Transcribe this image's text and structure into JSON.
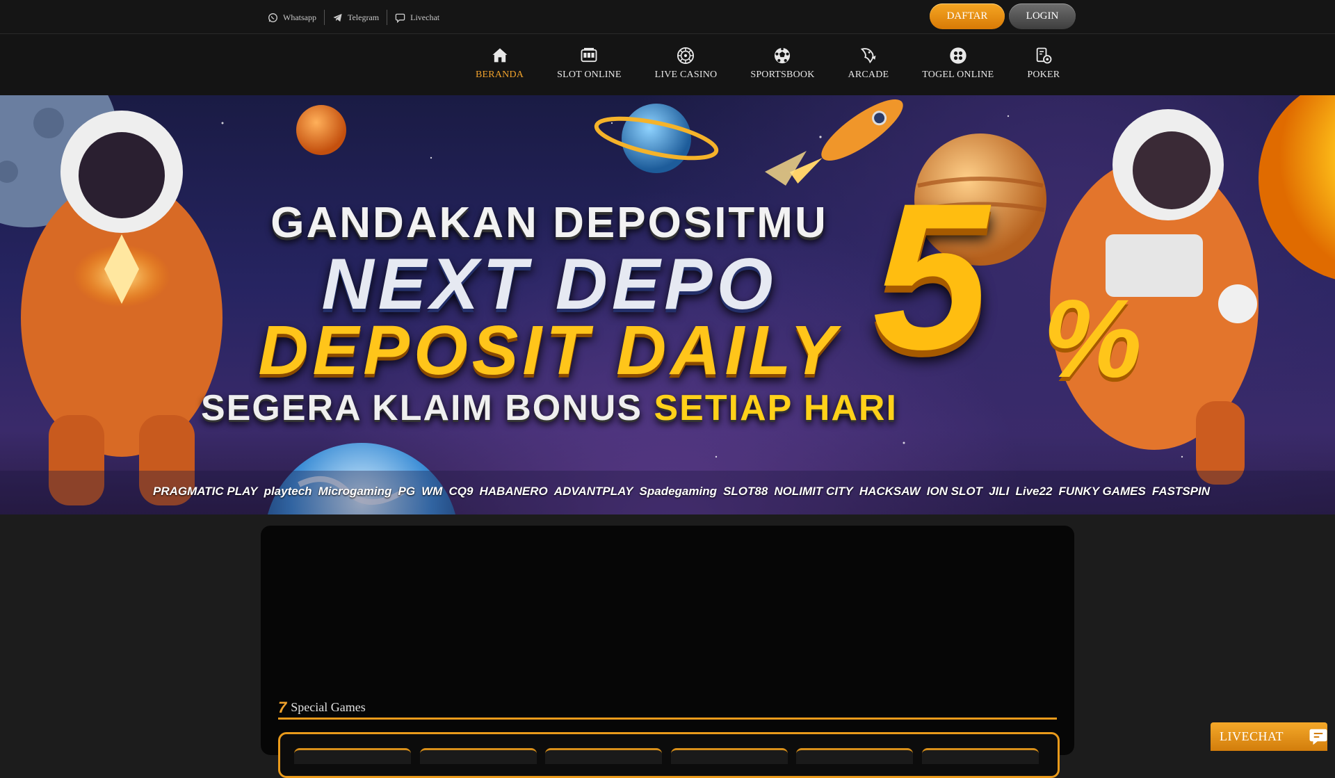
{
  "topbar": {
    "contacts": [
      {
        "label": "Whatsapp",
        "icon": "whatsapp-icon"
      },
      {
        "label": "Telegram",
        "icon": "telegram-icon"
      },
      {
        "label": "Livechat",
        "icon": "chat-bubble-icon"
      }
    ],
    "daftar_label": "DAFTAR",
    "login_label": "LOGIN"
  },
  "nav": {
    "items": [
      {
        "label": "BERANDA",
        "icon": "home-icon",
        "active": true
      },
      {
        "label": "SLOT ONLINE",
        "icon": "slot-machine-icon"
      },
      {
        "label": "LIVE CASINO",
        "icon": "roulette-icon"
      },
      {
        "label": "SPORTSBOOK",
        "icon": "soccer-ball-icon"
      },
      {
        "label": "ARCADE",
        "icon": "fish-icon"
      },
      {
        "label": "TOGEL ONLINE",
        "icon": "lottery-ball-icon"
      },
      {
        "label": "POKER",
        "icon": "poker-cards-icon"
      }
    ],
    "active_color": "#f0a22c"
  },
  "banner": {
    "line1": "GANDAKAN DEPOSITMU",
    "line2": "NEXT DEPO",
    "line3": "DEPOSIT DAILY",
    "line4_a": "SEGERA KLAIM BONUS",
    "line4_b": "SETIAP HARI",
    "percent_digit": "5",
    "percent_sign": "%",
    "providers": [
      "PRAGMATIC PLAY",
      "playtech",
      "Microgaming",
      "PG",
      "WM",
      "CQ9",
      "HABANERO",
      "ADVANTPLAY",
      "Spadegaming",
      "SLOT88",
      "NOLIMIT CITY",
      "HACKSAW",
      "ION SLOT",
      "JILI",
      "Live22",
      "FUNKY GAMES",
      "FASTSPIN"
    ]
  },
  "section": {
    "special_title": "Special Games",
    "seven_glyph": "7"
  },
  "livechat": {
    "label": "LIVECHAT"
  },
  "colors": {
    "accent": "#e99a1b",
    "background": "#1c1c1c"
  }
}
